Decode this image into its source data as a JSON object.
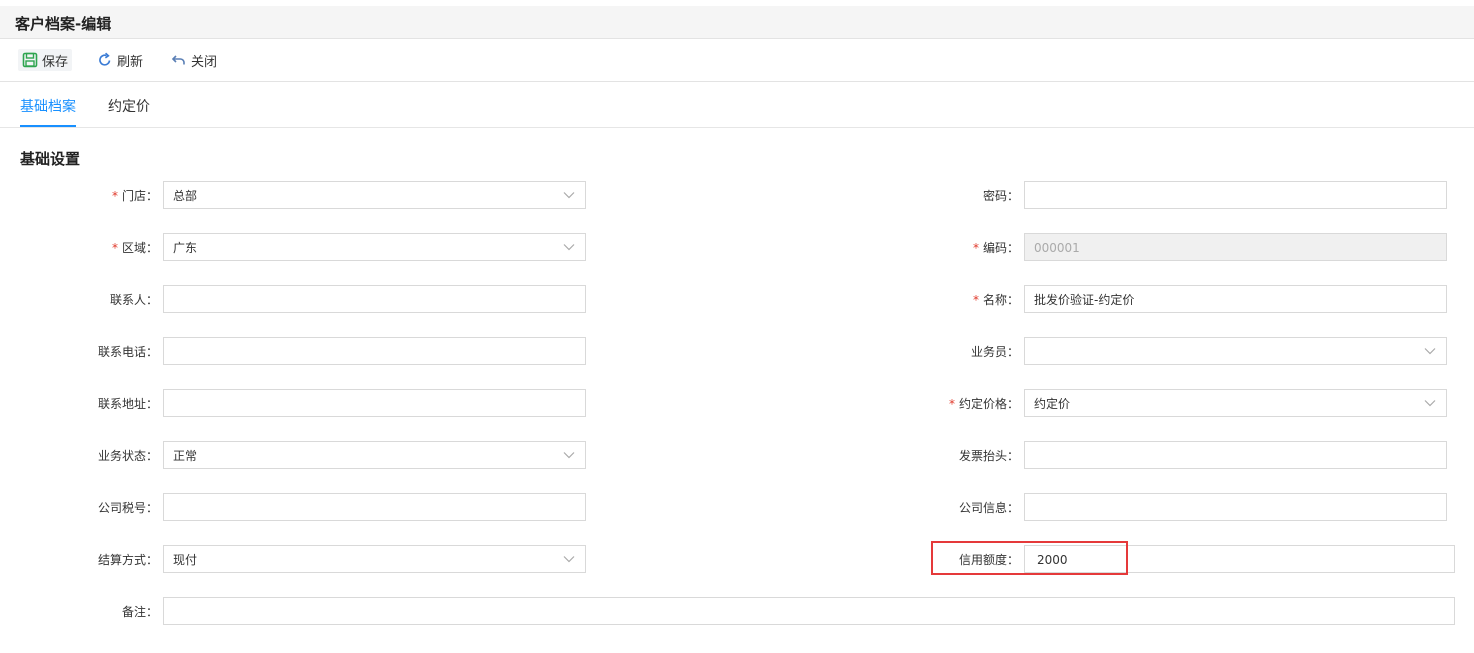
{
  "window": {
    "title": "客户档案-编辑"
  },
  "toolbar": {
    "save_label": "保存",
    "refresh_label": "刷新",
    "close_label": "关闭"
  },
  "tabs": [
    {
      "label": "基础档案",
      "active": true
    },
    {
      "label": "约定价",
      "active": false
    }
  ],
  "section": {
    "title": "基础设置"
  },
  "form": {
    "store": {
      "label": "门店：",
      "value": "总部",
      "required": true
    },
    "region": {
      "label": "区域：",
      "value": "广东",
      "required": true
    },
    "contact": {
      "label": "联系人：",
      "value": ""
    },
    "phone": {
      "label": "联系电话：",
      "value": ""
    },
    "address": {
      "label": "联系地址：",
      "value": ""
    },
    "business_status": {
      "label": "业务状态：",
      "value": "正常"
    },
    "tax_no": {
      "label": "公司税号：",
      "value": ""
    },
    "settlement": {
      "label": "结算方式：",
      "value": "现付"
    },
    "remark": {
      "label": "备注：",
      "value": ""
    },
    "password": {
      "label": "密码：",
      "value": ""
    },
    "code": {
      "label": "编码：",
      "value": "000001",
      "required": true,
      "disabled": true
    },
    "name": {
      "label": "名称：",
      "value": "批发价验证-约定价",
      "required": true
    },
    "salesman": {
      "label": "业务员：",
      "value": ""
    },
    "agreed_price": {
      "label": "约定价格：",
      "value": "约定价",
      "required": true
    },
    "invoice_title": {
      "label": "发票抬头：",
      "value": ""
    },
    "company_info": {
      "label": "公司信息：",
      "value": ""
    },
    "credit_limit": {
      "label": "信用额度：",
      "value": "2000"
    }
  },
  "colors": {
    "accent": "#1890ff",
    "required": "#e0392b",
    "highlight": "#e5393a",
    "save_icon": "#2ea44f",
    "refresh_icon": "#3a7bd5",
    "close_icon": "#5a7fb5"
  },
  "icons": {
    "save": "floppy-disk-icon",
    "refresh": "refresh-icon",
    "close": "undo-arrow-icon",
    "dropdown": "chevron-down-icon"
  }
}
